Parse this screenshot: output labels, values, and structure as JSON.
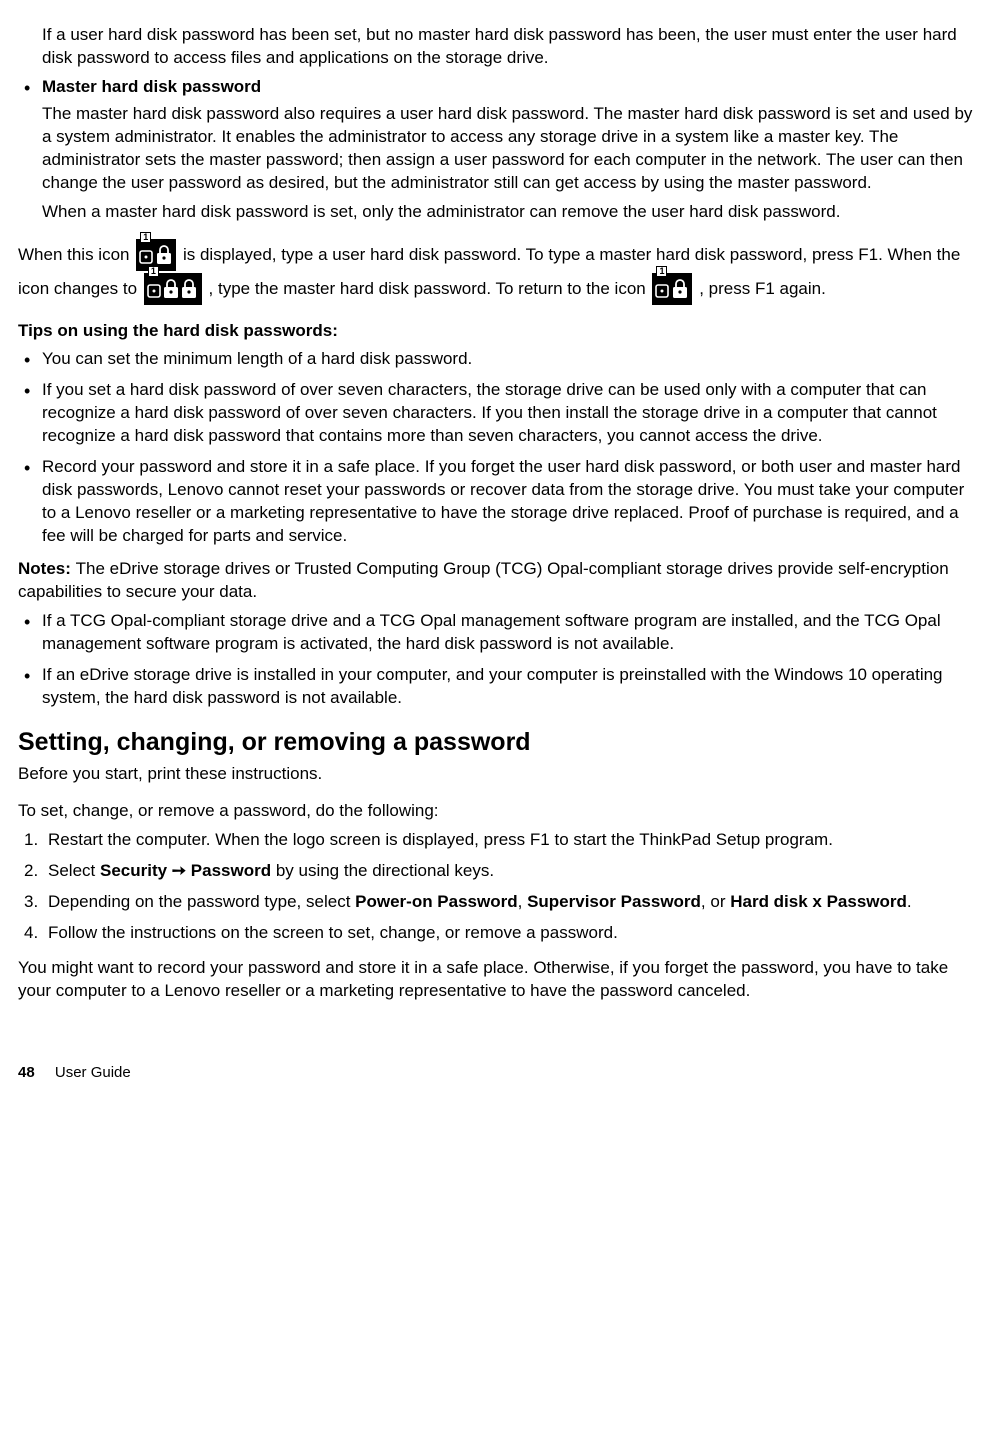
{
  "intro_user_pw": "If a user hard disk password has been set, but no master hard disk password has been, the user must enter the user hard disk password to access files and applications on the storage drive.",
  "master_heading": "Master hard disk password",
  "master_p1": "The master hard disk password also requires a user hard disk password. The master hard disk password is set and used by a system administrator. It enables the administrator to access any storage drive in a system like a master key. The administrator sets the master password; then assign a user password for each computer in the network. The user can then change the user password as desired, but the administrator still can get access by using the master password.",
  "master_p2": "When a master hard disk password is set, only the administrator can remove the user hard disk password.",
  "icon_para": {
    "s1": "When this icon ",
    "s2": " is displayed, type a user hard disk password. To type a master hard disk password, press F1. When the icon changes to ",
    "s3": ", type the master hard disk password. To return to the icon ",
    "s4": " , press F1 again."
  },
  "tips_heading": "Tips on using the hard disk passwords:",
  "tips": [
    "You can set the minimum length of a hard disk password.",
    "If you set a hard disk password of over seven characters, the storage drive can be used only with a computer that can recognize a hard disk password of over seven characters. If you then install the storage drive in a computer that cannot recognize a hard disk password that contains more than seven characters, you cannot access the drive.",
    "Record your password and store it in a safe place. If you forget the user hard disk password, or both user and master hard disk passwords, Lenovo cannot reset your passwords or recover data from the storage drive. You must take your computer to a Lenovo reseller or a marketing representative to have the storage drive replaced. Proof of purchase is required, and a fee will be charged for parts and service."
  ],
  "notes_label": "Notes:  ",
  "notes_intro": "The eDrive storage drives or Trusted Computing Group (TCG) Opal-compliant storage drives provide self-encryption capabilities to secure your data.",
  "notes": [
    "If a TCG Opal-compliant storage drive and a TCG Opal management software program are installed, and the TCG Opal management software program is activated, the hard disk password is not available.",
    "If an eDrive storage drive is installed in your computer, and your computer is preinstalled with the Windows 10 operating system, the hard disk password is not available."
  ],
  "section_heading": "Setting, changing, or removing a password",
  "section_intro": "Before you start, print these instructions.",
  "section_lead": "To set, change, or remove a password, do the following:",
  "steps": {
    "s1": "Restart the computer. When the logo screen is displayed, press F1 to start the ThinkPad Setup program.",
    "s2a": "Select ",
    "s2b_security": "Security",
    "s2b_arrow": " ➙ ",
    "s2b_password": "Password",
    "s2c": " by using the directional keys.",
    "s3a": "Depending on the password type, select ",
    "s3_poweron": "Power-on Password",
    "s3_sep1": ", ",
    "s3_supervisor": "Supervisor Password",
    "s3_sep2": ", or ",
    "s3_harddisk": "Hard disk x Password",
    "s3_end": ".",
    "s4": "Follow the instructions on the screen to set, change, or remove a password."
  },
  "closing": "You might want to record your password and store it in a safe place. Otherwise, if you forget the password, you have to take your computer to a Lenovo reseller or a marketing representative to have the password canceled.",
  "footer": {
    "page": "48",
    "title": "User Guide"
  }
}
